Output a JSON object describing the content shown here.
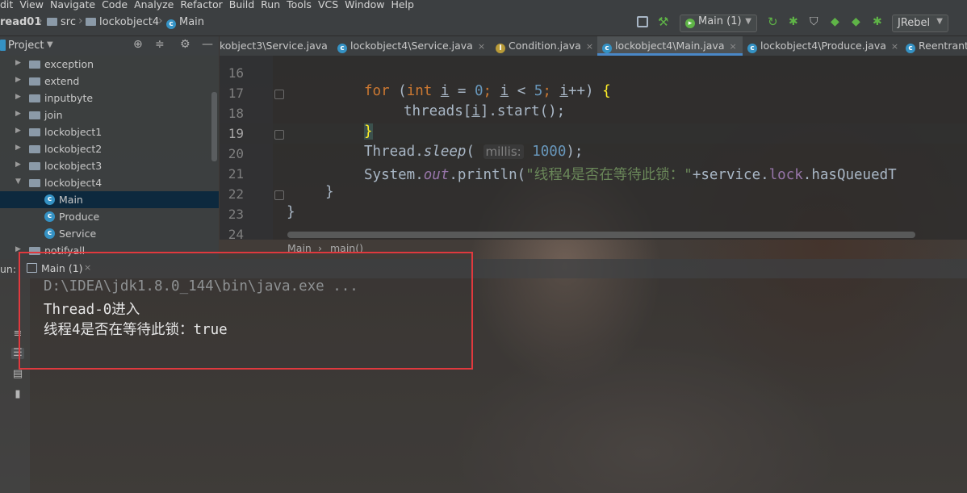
{
  "menubar": {
    "items": [
      "Edit",
      "View",
      "Navigate",
      "Code",
      "Analyze",
      "Refactor",
      "Build",
      "Run",
      "Tools",
      "VCS",
      "Window",
      "Help"
    ],
    "visible_labels": [
      "dit",
      "View",
      "Navigate",
      "Code",
      "Analyze",
      "Refactor",
      "Build",
      "Run",
      "Tools",
      "VCS",
      "Window",
      "Help"
    ]
  },
  "navbar": {
    "project": "read01",
    "src": "src",
    "package": "lockobject4",
    "file": "Main",
    "run_config": "Main (1)",
    "jrebel": "JRebel"
  },
  "project_panel": {
    "title": "Project",
    "tree": [
      {
        "label": "exception",
        "type": "folder",
        "expanded": false
      },
      {
        "label": "extend",
        "type": "folder",
        "expanded": false
      },
      {
        "label": "inputbyte",
        "type": "folder",
        "expanded": false
      },
      {
        "label": "join",
        "type": "folder",
        "expanded": false
      },
      {
        "label": "lockobject1",
        "type": "folder",
        "expanded": false
      },
      {
        "label": "lockobject2",
        "type": "folder",
        "expanded": false
      },
      {
        "label": "lockobject3",
        "type": "folder",
        "expanded": false
      },
      {
        "label": "lockobject4",
        "type": "folder",
        "expanded": true
      },
      {
        "label": "Main",
        "type": "class",
        "selected": true
      },
      {
        "label": "Produce",
        "type": "class"
      },
      {
        "label": "Service",
        "type": "class"
      },
      {
        "label": "notifyall",
        "type": "folder",
        "expanded": false
      }
    ]
  },
  "editor_tabs": [
    {
      "label": "kobject3\\Service.java",
      "active": false
    },
    {
      "label": "lockobject4\\Service.java",
      "active": false
    },
    {
      "label": "Condition.java",
      "active": false
    },
    {
      "label": "lockobject4\\Main.java",
      "active": true
    },
    {
      "label": "lockobject4\\Produce.java",
      "active": false
    },
    {
      "label": "ReentrantL",
      "active": false
    }
  ],
  "editor": {
    "line_numbers": [
      "16",
      "17",
      "18",
      "19",
      "20",
      "21",
      "22",
      "23",
      "24"
    ],
    "current_line": "19",
    "code": {
      "l17_for": "for",
      "l17_int": "int",
      "l17_i": "i",
      "l17_eq": " = ",
      "l17_zero": "0",
      "l17_semi1": "; ",
      "l17_i2": "i",
      "l17_lt": " < ",
      "l17_five": "5",
      "l17_semi2": "; ",
      "l17_i3": "i",
      "l17_inc": "++) ",
      "l17_open": "{",
      "l18_a": "threads[",
      "l18_i": "i",
      "l18_b": "].start();",
      "l19_close": "}",
      "l20_a": "Thread.",
      "l20_sleep": "sleep",
      "l20_paren": "( ",
      "l20_hint": "millis:",
      "l20_num": "1000",
      "l20_end": ");",
      "l21_a": "System.",
      "l21_out": "out",
      "l21_b": ".println(",
      "l21_str": "\"线程4是否在等待此锁：\"",
      "l21_c": "+service.",
      "l21_lock": "lock",
      "l21_d": ".hasQueuedT",
      "l22": "}",
      "l23": "}"
    },
    "breadcrumb": [
      "Main",
      "main()"
    ]
  },
  "run_panel": {
    "label": "un:",
    "tab": "Main (1)",
    "console": [
      "D:\\IDEA\\jdk1.8.0_144\\bin\\java.exe ...",
      "Thread-0进入",
      "线程4是否在等待此锁：true"
    ]
  },
  "colors": {
    "accent": "#4a88c7",
    "highlight_box": "#e0393e",
    "keyword": "#cc7832",
    "number": "#6897bb",
    "string": "#6a8759"
  }
}
